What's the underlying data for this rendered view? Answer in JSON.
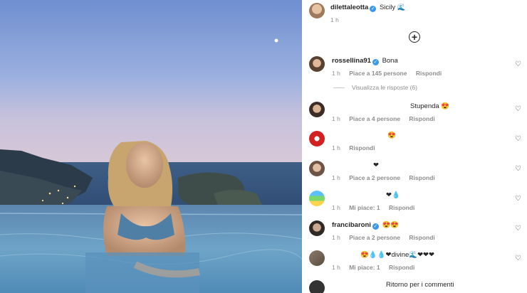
{
  "post": {
    "username": "dilettaleotta",
    "verified": true,
    "caption": "Sicily 🌊",
    "time": "1 h",
    "add_icon": "plus-circle-icon"
  },
  "comments": [
    {
      "username": "rossellina91",
      "verified": true,
      "text": "Bona",
      "time": "1 h",
      "likes": "Piace a 145 persone",
      "reply": "Rispondi"
    },
    {
      "username": "",
      "verified": false,
      "text": "Stupenda 😍",
      "time": "1 h",
      "likes": "Piace a 4 persone",
      "reply": "Rispondi"
    },
    {
      "username": "",
      "verified": false,
      "text": "😍",
      "time": "1 h",
      "likes": "",
      "reply": "Rispondi"
    },
    {
      "username": "",
      "verified": false,
      "text": "❤",
      "time": "1 h",
      "likes": "Piace a 2 persone",
      "reply": "Rispondi"
    },
    {
      "username": "",
      "verified": false,
      "text": "❤💧",
      "time": "1 h",
      "likes": "Mi piace: 1",
      "reply": "Rispondi"
    },
    {
      "username": "francibaroni",
      "verified": true,
      "text": "😍😍",
      "time": "1 h",
      "likes": "Piace a 2 persone",
      "reply": "Rispondi"
    },
    {
      "username": "",
      "verified": false,
      "text": "😍💧💧❤divine🌊❤❤❤",
      "time": "1 h",
      "likes": "Mi piace: 1",
      "reply": "Rispondi"
    }
  ],
  "view_replies": "Visualizza le risposte (6)",
  "footer": "Ritorno per i commenti",
  "colors": {
    "verified": "#3897f0",
    "muted": "#8e8e8e",
    "text": "#262626"
  }
}
